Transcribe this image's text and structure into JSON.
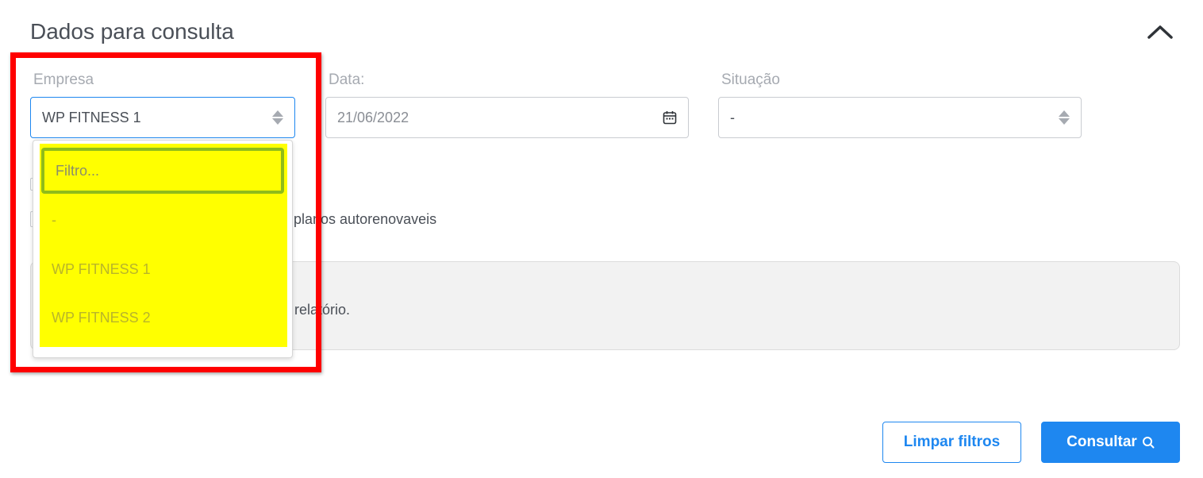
{
  "section": {
    "title": "Dados para consulta"
  },
  "fields": {
    "empresa": {
      "label": "Empresa",
      "value": "WP FITNESS 1"
    },
    "data": {
      "label": "Data:",
      "value": "21/06/2022"
    },
    "situacao": {
      "label": "Situação",
      "value": "-"
    }
  },
  "dropdown": {
    "filter_placeholder": "Filtro...",
    "options": [
      "-",
      "WP FITNESS 1",
      "WP FITNESS 2"
    ]
  },
  "checkbox_text": "zar planos autorenovaveis",
  "info_text": "relatório.",
  "buttons": {
    "clear_label": "Limpar filtros",
    "submit_label": "Consultar"
  },
  "icons": {
    "collapse": "chevron-up-icon",
    "calendar": "calendar-icon",
    "search": "search-icon"
  },
  "colors": {
    "accent": "#1e87f0",
    "highlight_frame": "#ff0000",
    "highlight_fill": "#ffff00",
    "filter_border": "#8fbc1a"
  }
}
